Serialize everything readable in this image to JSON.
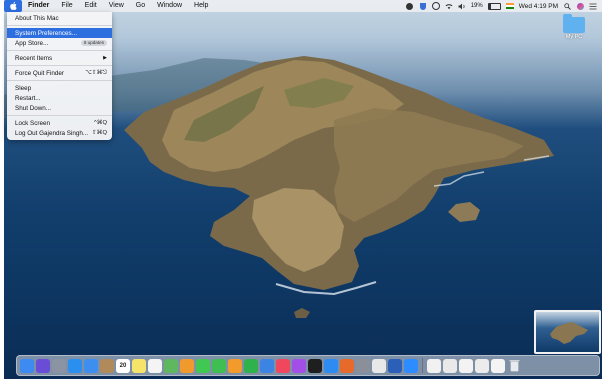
{
  "menubar": {
    "app_name": "Finder",
    "items": [
      "File",
      "Edit",
      "View",
      "Go",
      "Window",
      "Help"
    ],
    "battery_percent": "19%",
    "clock": "Wed 4:19 PM"
  },
  "apple_menu": {
    "items": [
      {
        "label": "About This Mac"
      },
      {
        "label": "System Preferences...",
        "selected": true
      },
      {
        "label": "App Store...",
        "badge": "6 updates"
      },
      {
        "label": "Recent Items",
        "submenu": true
      },
      {
        "label": "Force Quit Finder",
        "shortcut": "⌥⇧⌘⎋"
      },
      {
        "label": "Sleep"
      },
      {
        "label": "Restart..."
      },
      {
        "label": "Shut Down..."
      },
      {
        "label": "Lock Screen",
        "shortcut": "^⌘Q"
      },
      {
        "label": "Log Out Gajendra Singh...",
        "shortcut": "⇧⌘Q"
      }
    ]
  },
  "desktop": {
    "folder_label": "My PC"
  },
  "dock": {
    "calendar_day": "20",
    "apps": [
      {
        "icon": "finder-icon",
        "color": "#3d8bf0"
      },
      {
        "icon": "siri-icon",
        "color": "#6a4cd6"
      },
      {
        "icon": "launchpad-icon",
        "color": "#8c93a3"
      },
      {
        "icon": "safari-icon",
        "color": "#2b8ff0"
      },
      {
        "icon": "mail-icon",
        "color": "#3d8fef"
      },
      {
        "icon": "contacts-icon",
        "color": "#b08a5a"
      },
      {
        "icon": "calendar-icon",
        "color": "#ffffff"
      },
      {
        "icon": "notes-icon",
        "color": "#f6e36a"
      },
      {
        "icon": "reminders-icon",
        "color": "#f4f4f4"
      },
      {
        "icon": "maps-icon",
        "color": "#5fb760"
      },
      {
        "icon": "photos-icon",
        "color": "#f09a2e"
      },
      {
        "icon": "messages-icon",
        "color": "#41c853"
      },
      {
        "icon": "facetime-icon",
        "color": "#3fbf52"
      },
      {
        "icon": "pages-icon",
        "color": "#f29a2c"
      },
      {
        "icon": "numbers-icon",
        "color": "#2fb14c"
      },
      {
        "icon": "keynote-icon",
        "color": "#3d83e4"
      },
      {
        "icon": "music-icon",
        "color": "#f0475e"
      },
      {
        "icon": "podcasts-icon",
        "color": "#a34ee6"
      },
      {
        "icon": "tv-icon",
        "color": "#1f1f1f"
      },
      {
        "icon": "app-store-icon",
        "color": "#2d8bf2"
      },
      {
        "icon": "firefox-icon",
        "color": "#e86a2a"
      },
      {
        "icon": "system-preferences-icon",
        "color": "#8a8f99"
      },
      {
        "icon": "chrome-icon",
        "color": "#e8e8e8"
      },
      {
        "icon": "word-icon",
        "color": "#2b5fb8"
      },
      {
        "icon": "zoom-icon",
        "color": "#2d8cff"
      }
    ],
    "docs": [
      {
        "icon": "document-thumbnail-1-icon",
        "color": "#f1f1f1"
      },
      {
        "icon": "document-thumbnail-2-icon",
        "color": "#e9e9e9"
      },
      {
        "icon": "document-thumbnail-3-icon",
        "color": "#f3f3f3"
      },
      {
        "icon": "document-thumbnail-4-icon",
        "color": "#ececec"
      },
      {
        "icon": "document-thumbnail-5-icon",
        "color": "#f4f4f4"
      }
    ]
  },
  "colors": {
    "menu_highlight": "#2e6fe0",
    "folder_blue": "#5fb2ef"
  }
}
